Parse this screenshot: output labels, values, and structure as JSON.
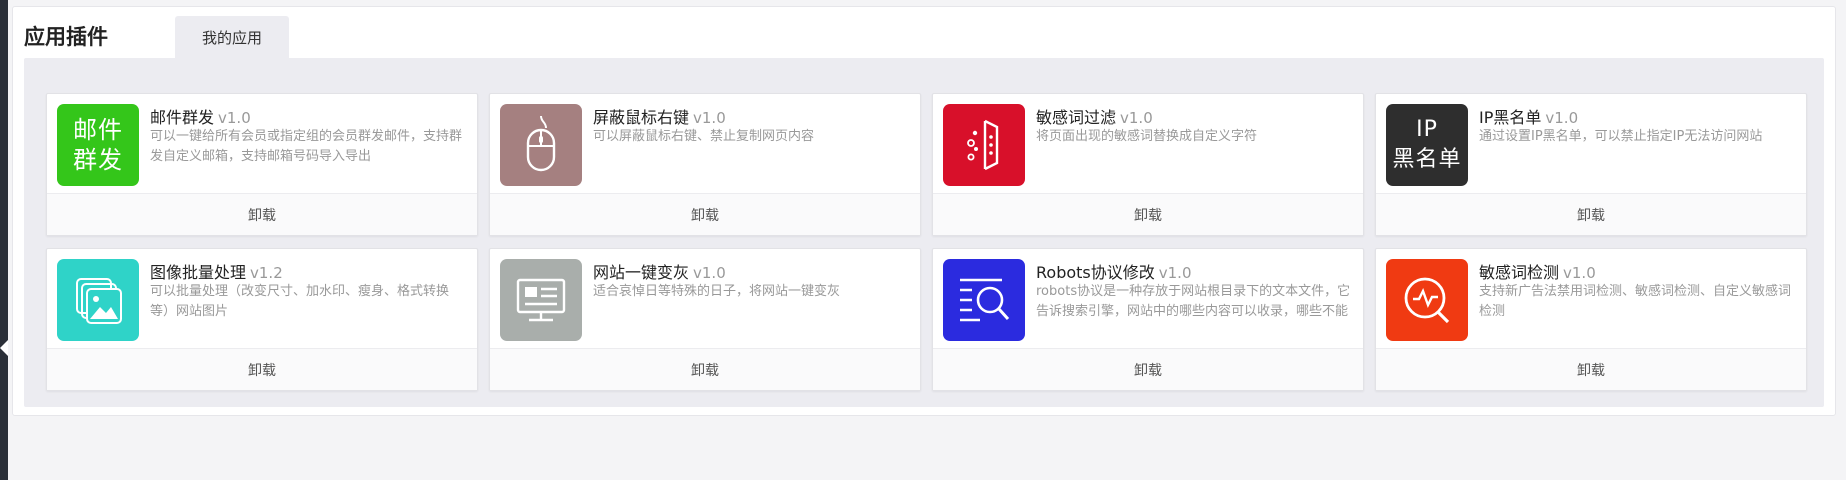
{
  "page": {
    "title": "应用插件",
    "tabs": [
      {
        "label": "我的应用"
      }
    ]
  },
  "plugins": [
    {
      "name": "邮件群发",
      "version": "v1.0",
      "desc": "可以一键给所有会员或指定组的会员群发邮件，支持群发自定义邮箱，支持邮箱号码导入导出",
      "icon": "mail-broadcast-icon",
      "icon_text": "邮件\n群发",
      "color": "#34c61a",
      "action": "卸载"
    },
    {
      "name": "屏蔽鼠标右键",
      "version": "v1.0",
      "desc": "可以屏蔽鼠标右键、禁止复制网页内容",
      "icon": "mouse-icon",
      "color": "#a58080",
      "action": "卸载"
    },
    {
      "name": "敏感词过滤",
      "version": "v1.0",
      "desc": "将页面出现的敏感词替换成自定义字符",
      "icon": "filter-icon",
      "color": "#d8102a",
      "action": "卸载"
    },
    {
      "name": "IP黑名单",
      "version": "v1.0",
      "desc": "通过设置IP黑名单，可以禁止指定IP无法访问网站",
      "icon": "ip-blacklist-icon",
      "icon_text": "IP\n黑名单",
      "color": "#2e2e2e",
      "action": "卸载"
    },
    {
      "name": "图像批量处理",
      "version": "v1.2",
      "desc": "可以批量处理（改变尺寸、加水印、瘦身、格式转换等）网站图片",
      "icon": "image-stack-icon",
      "color": "#2fd3c8",
      "action": "卸载"
    },
    {
      "name": "网站一键变灰",
      "version": "v1.0",
      "desc": "适合哀悼日等特殊的日子，将网站一键变灰",
      "icon": "monitor-icon",
      "color": "#a9aeab",
      "action": "卸载"
    },
    {
      "name": "Robots协议修改",
      "version": "v1.0",
      "desc": "robots协议是一种存放于网站根目录下的文本文件，它告诉搜索引擎，网站中的哪些内容可以收录，哪些不能",
      "icon": "search-list-icon",
      "color": "#2b2bdf",
      "action": "卸载"
    },
    {
      "name": "敏感词检测",
      "version": "v1.0",
      "desc": "支持新广告法禁用词检测、敏感词检测、自定义敏感词检测",
      "icon": "detect-icon",
      "color": "#f03a12",
      "action": "卸载"
    }
  ]
}
